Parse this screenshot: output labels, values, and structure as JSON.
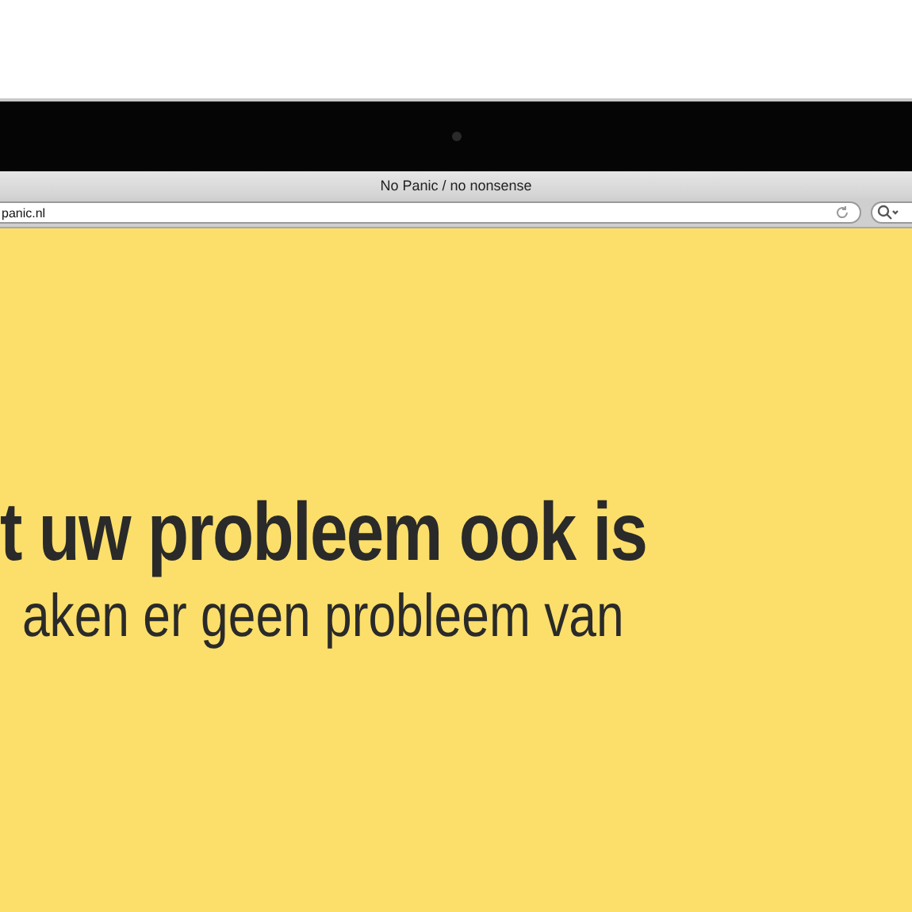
{
  "window": {
    "title": "No Panic / no nonsense"
  },
  "address_bar": {
    "value": "panic.nl"
  },
  "page": {
    "heading": "t uw probleem ook is",
    "subheading": "aken er geen probleem van"
  }
}
